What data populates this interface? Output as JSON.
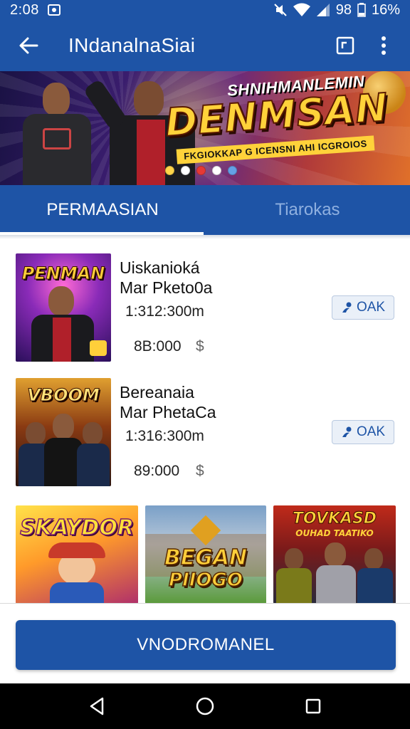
{
  "status_bar": {
    "time": "2:08",
    "signal_text": "98",
    "battery_percent": "16%"
  },
  "app_bar": {
    "title": "INdanalnaSiai",
    "back_icon": "arrow-left-icon",
    "actions": [
      "square-icon",
      "more-vert-icon"
    ]
  },
  "banner": {
    "headline_top": "SHNIHMANLEMIN",
    "headline": "DENMSAN",
    "subline": "FKGIOKKAP G ICENSNI AHI ICGROIOS",
    "carousel_dots": [
      "#ffd54a",
      "#ffffff",
      "#e53935",
      "#ffffff",
      "#64a0e6"
    ]
  },
  "tabs": [
    {
      "label": "PERMAASIAN",
      "active": true
    },
    {
      "label": "Tiarokas",
      "active": false
    }
  ],
  "items": [
    {
      "thumb_title": "PENMAN",
      "name_line1": "Uiskanioká",
      "name_line2": "Mar Pketo0a",
      "meta": "1:312:300m",
      "price": "8B:000",
      "price_icon": "$",
      "button_label": "OAK"
    },
    {
      "thumb_title": "VBOOM",
      "name_line1": "Bereanaia",
      "name_line2": "Mar PhetaCa",
      "meta": "1:316:300m",
      "price": "89:000",
      "price_icon": "$",
      "button_label": "OAK"
    }
  ],
  "grid": [
    {
      "title": "SKAYDOR"
    },
    {
      "title_line1": "BEGAN",
      "title_line2": "PIIOGO"
    },
    {
      "title_line1": "TOVKASD",
      "title_line2": "OUHAD TAATIKO"
    }
  ],
  "cta": {
    "label": "VNODROMANEL"
  },
  "colors": {
    "primary": "#1e54a6",
    "tab_inactive": "#8fb0e0",
    "button_bg": "#eaf0f8"
  }
}
